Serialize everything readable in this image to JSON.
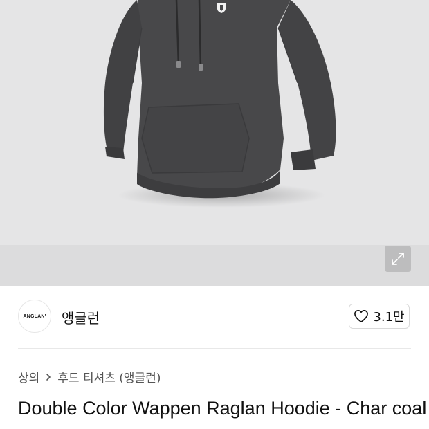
{
  "product_image": {
    "alt": "charcoal hoodie",
    "expand_icon": "expand-arrows-icon"
  },
  "brand": {
    "logo_text": "ANGLAN'",
    "name": "앵글런"
  },
  "like": {
    "icon": "heart-outline-icon",
    "count": "3.1만"
  },
  "breadcrumb": {
    "items": [
      "상의",
      "후드 티셔츠 (앵글런)"
    ],
    "separator_icon": "chevron-right-icon"
  },
  "product": {
    "title": "Double Color Wappen Raglan Hoodie - Char coal"
  },
  "colors": {
    "hoodie": "#4a4a4c",
    "background": "#e5e5e6"
  }
}
